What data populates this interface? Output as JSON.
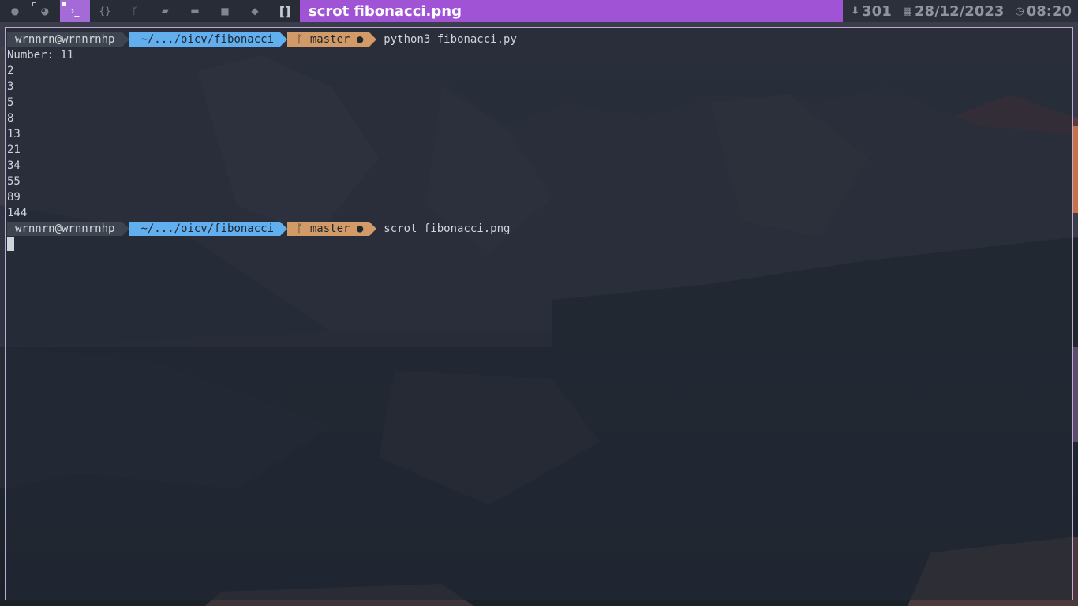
{
  "window_title": "scrot fibonacci.png",
  "workspaces": [
    {
      "icon": "firefox-icon",
      "glyph": "●"
    },
    {
      "icon": "chrome-icon",
      "glyph": "◕"
    },
    {
      "icon": "terminal-icon",
      "glyph": "›_"
    },
    {
      "icon": "code-braces-icon",
      "glyph": "{}"
    },
    {
      "icon": "git-branch-icon",
      "glyph": "ᚴ"
    },
    {
      "icon": "docker-icon",
      "glyph": "▰"
    },
    {
      "icon": "folder-icon",
      "glyph": "▬"
    },
    {
      "icon": "video-camera-icon",
      "glyph": "■"
    },
    {
      "icon": "layers-icon",
      "glyph": "◆"
    },
    {
      "icon": "layout-brackets-icon",
      "glyph": "[]"
    }
  ],
  "status": {
    "updates": "301",
    "date": "28/12/2023",
    "time": "08:20"
  },
  "terminal": {
    "prompt": {
      "user": "wrnnrn@wrnnrnhp",
      "path": "~/.../oicv/fibonacci",
      "branch_icon": "ᚴ",
      "branch": "master ●"
    },
    "command1": "python3 fibonacci.py",
    "output": [
      "Number: 11",
      "2",
      "3",
      "5",
      "8",
      "13",
      "21",
      "34",
      "55",
      "89",
      "144"
    ],
    "command2": "scrot fibonacci.png"
  },
  "colors": {
    "active_workspace": "#a46bd8",
    "title_bar": "#a153d6",
    "prompt_user_bg": "#3e4550",
    "prompt_path_bg": "#61afef",
    "prompt_git_bg": "#d19a66",
    "terminal_border": "#c2a7d6"
  }
}
